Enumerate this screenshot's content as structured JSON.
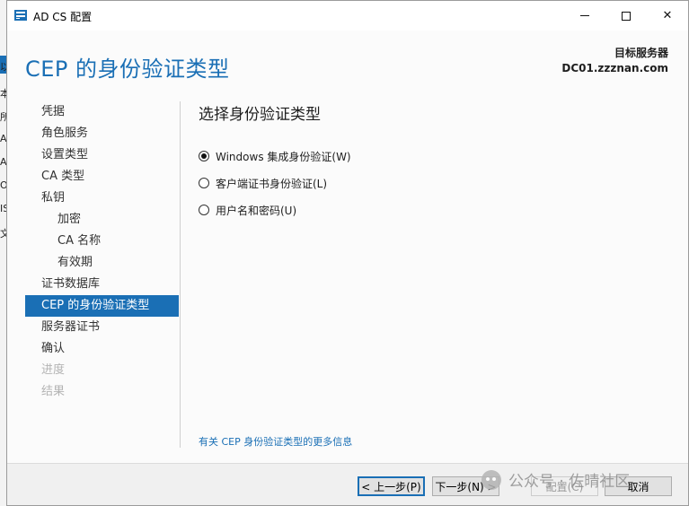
{
  "background_window": {
    "glyphs": [
      "以",
      "本",
      "所",
      "A",
      "A",
      "O",
      "IS",
      "文"
    ]
  },
  "window": {
    "title": "AD CS 配置",
    "controls": {
      "minimize": "minimize-icon",
      "maximize": "maximize-icon",
      "close": "✕"
    }
  },
  "header": {
    "page_title": "CEP 的身份验证类型",
    "target_label": "目标服务器",
    "target_value": "DC01.zzznan.com"
  },
  "nav": {
    "items": [
      {
        "label": "凭据",
        "state": "normal",
        "level": 0
      },
      {
        "label": "角色服务",
        "state": "normal",
        "level": 0
      },
      {
        "label": "设置类型",
        "state": "normal",
        "level": 0
      },
      {
        "label": "CA 类型",
        "state": "normal",
        "level": 0
      },
      {
        "label": "私钥",
        "state": "normal",
        "level": 0
      },
      {
        "label": "加密",
        "state": "normal",
        "level": 1
      },
      {
        "label": "CA 名称",
        "state": "normal",
        "level": 1
      },
      {
        "label": "有效期",
        "state": "normal",
        "level": 1
      },
      {
        "label": "证书数据库",
        "state": "normal",
        "level": 0
      },
      {
        "label": "CEP 的身份验证类型",
        "state": "active",
        "level": 0
      },
      {
        "label": "服务器证书",
        "state": "normal",
        "level": 0
      },
      {
        "label": "确认",
        "state": "normal",
        "level": 0
      },
      {
        "label": "进度",
        "state": "disabled",
        "level": 0
      },
      {
        "label": "结果",
        "state": "disabled",
        "level": 0
      }
    ]
  },
  "main": {
    "section_title": "选择身份验证类型",
    "options": [
      {
        "label": "Windows 集成身份验证(W)",
        "checked": true
      },
      {
        "label": "客户端证书身份验证(L)",
        "checked": false
      },
      {
        "label": "用户名和密码(U)",
        "checked": false
      }
    ],
    "more_info_link": "有关 CEP 身份验证类型的更多信息"
  },
  "footer": {
    "prev": "< 上一步(P)",
    "next": "下一步(N) >",
    "configure": "配置(C)",
    "cancel": "取消"
  },
  "watermark": {
    "text": "公众号 · 佐晴社区"
  },
  "colors": {
    "accent": "#1a6fb5",
    "disabled": "#b3b3b3"
  }
}
